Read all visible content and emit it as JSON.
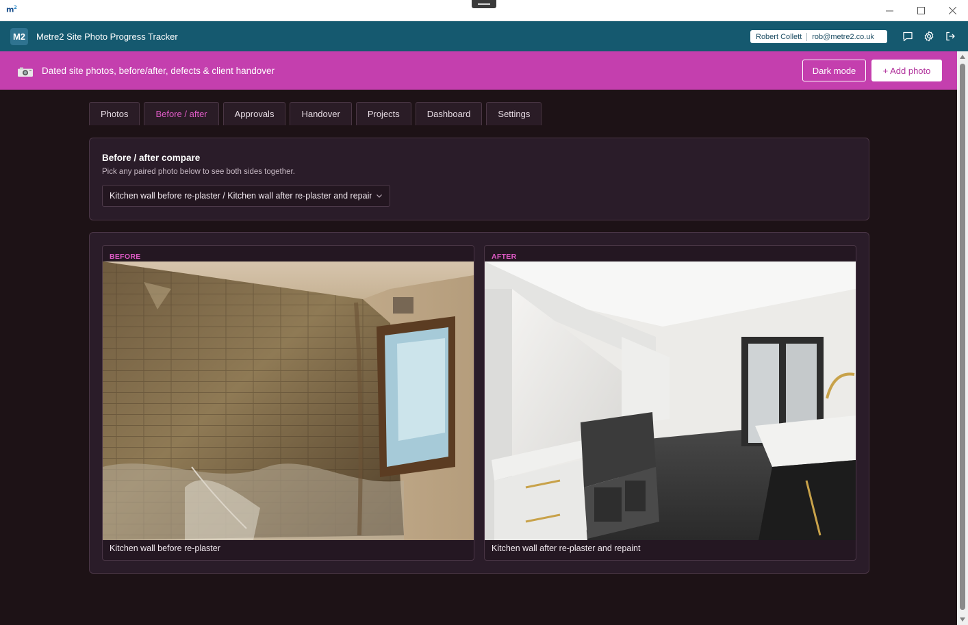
{
  "window": {
    "logo_text": "m",
    "logo_sup": "2",
    "controls": [
      "minimize",
      "maximize",
      "close"
    ]
  },
  "header": {
    "badge": "M2",
    "title": "Metre2 Site Photo Progress Tracker",
    "user_name": "Robert Collett",
    "user_email": "rob@metre2.co.uk",
    "icons": [
      "feedback-icon",
      "settings-gear-icon",
      "logout-icon"
    ]
  },
  "banner": {
    "tagline": "Dated site photos, before/after, defects & client handover",
    "dark_mode_label": "Dark mode",
    "add_photo_label": "+ Add photo",
    "color": "#c43fae"
  },
  "tabs": [
    {
      "label": "Photos",
      "active": false
    },
    {
      "label": "Before / after",
      "active": true
    },
    {
      "label": "Approvals",
      "active": false
    },
    {
      "label": "Handover",
      "active": false
    },
    {
      "label": "Projects",
      "active": false
    },
    {
      "label": "Dashboard",
      "active": false
    },
    {
      "label": "Settings",
      "active": false
    }
  ],
  "compare": {
    "heading": "Before / after compare",
    "subtitle": "Pick any paired photo below to see both sides together.",
    "selected_pair": "Kitchen wall before re-plaster / Kitchen wall after re-plaster and repaint"
  },
  "before": {
    "label": "BEFORE",
    "caption": "Kitchen wall before re-plaster"
  },
  "after": {
    "label": "AFTER",
    "caption": "Kitchen wall after re-plaster and repaint"
  },
  "colors": {
    "accent": "#e05bc7",
    "header": "#15596f",
    "background": "#1d1216"
  }
}
